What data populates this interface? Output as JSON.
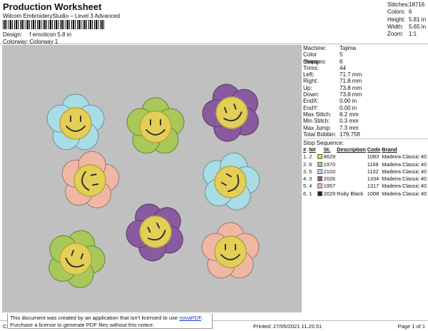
{
  "header": {
    "title": "Production Worksheet",
    "subtitle": "Wilcom EmbroideryStudio – Level 3 Advanced",
    "design_label": "Design:",
    "design_value": "f emoticon 5.8 in",
    "colorway_label": "Colorway:",
    "colorway_value": "Colorway 1"
  },
  "stats": [
    {
      "label": "Stitches:",
      "value": "18716"
    },
    {
      "label": "Colors:",
      "value": "6"
    },
    {
      "label": "Height:",
      "value": "5.81 in"
    },
    {
      "label": "Width:",
      "value": "5.65 in"
    },
    {
      "label": "Zoom:",
      "value": "1:1"
    }
  ],
  "machine_info": [
    {
      "label": "Machine:",
      "value": "Tajima"
    },
    {
      "label": "Color changes:",
      "value": "5"
    },
    {
      "label": "Stops:",
      "value": "6"
    },
    {
      "label": "Trims:",
      "value": "44"
    },
    {
      "label": "Left:",
      "value": "71.7 mm"
    },
    {
      "label": "Right:",
      "value": "71.8 mm"
    },
    {
      "label": "Up:",
      "value": "73.8 mm"
    },
    {
      "label": "Down:",
      "value": "73.8 mm"
    },
    {
      "label": "EndX:",
      "value": "0.00 in"
    },
    {
      "label": "EndY:",
      "value": "0.00 in"
    },
    {
      "label": "Max Stitch:",
      "value": "8.2 mm"
    },
    {
      "label": "Min Stitch:",
      "value": "0.3 mm"
    },
    {
      "label": "Max Jump:",
      "value": "7.3 mm"
    },
    {
      "label": "Total Bobbin:",
      "value": "179.75ft"
    }
  ],
  "stop_sequence": {
    "title": "Stop Sequence:",
    "columns": [
      "#",
      "N#",
      "St.",
      "Description",
      "Code",
      "Brand"
    ],
    "rows": [
      {
        "idx": "1.",
        "n": "2",
        "st": "8629",
        "desc": "",
        "code": "1083",
        "brand": "Madeira Classic 40",
        "color": "#e3cf55"
      },
      {
        "idx": "2.",
        "n": "6",
        "st": "1970",
        "desc": "",
        "code": "1168",
        "brand": "Madeira Classic 40",
        "color": "#a8c85a"
      },
      {
        "idx": "3.",
        "n": "5",
        "st": "2103",
        "desc": "",
        "code": "1132",
        "brand": "Madeira Classic 40",
        "color": "#a9dde6"
      },
      {
        "idx": "4.",
        "n": "3",
        "st": "2026",
        "desc": "",
        "code": "1334",
        "brand": "Madeira Classic 40",
        "color": "#8a5aa0"
      },
      {
        "idx": "5.",
        "n": "4",
        "st": "1957",
        "desc": "",
        "code": "1317",
        "brand": "Madeira Classic 40",
        "color": "#f0b8a4"
      },
      {
        "idx": "6.",
        "n": "1",
        "st": "2029",
        "desc": "Ruby Black",
        "code": "1008",
        "brand": "Madeira Classic 40",
        "color": "#222222"
      }
    ]
  },
  "design_flowers": [
    {
      "petal": "#a9dde6",
      "rot": 0
    },
    {
      "petal": "#a8c85a",
      "rot": 0
    },
    {
      "petal": "#8a5aa0",
      "rot": -20
    },
    {
      "petal": "#f0b8a4",
      "rot": 80
    },
    {
      "petal": "#a9dde6",
      "rot": -60
    },
    {
      "petal": "#8a5aa0",
      "rot": -25
    },
    {
      "petal": "#a8c85a",
      "rot": 20
    },
    {
      "petal": "#f0b8a4",
      "rot": 0
    }
  ],
  "face_color": "#e3cf55",
  "footer": {
    "left": "Cr",
    "printed": "Printed: 27/05/2021 11.20.51",
    "page": "Page 1 of 1"
  },
  "notice": {
    "line1_prefix": "This document was created by an application that isn’t licensed to use ",
    "link": "novaPDF",
    "line1_suffix": ".",
    "line2": "Purchase a license to generate PDF files without this notice."
  }
}
